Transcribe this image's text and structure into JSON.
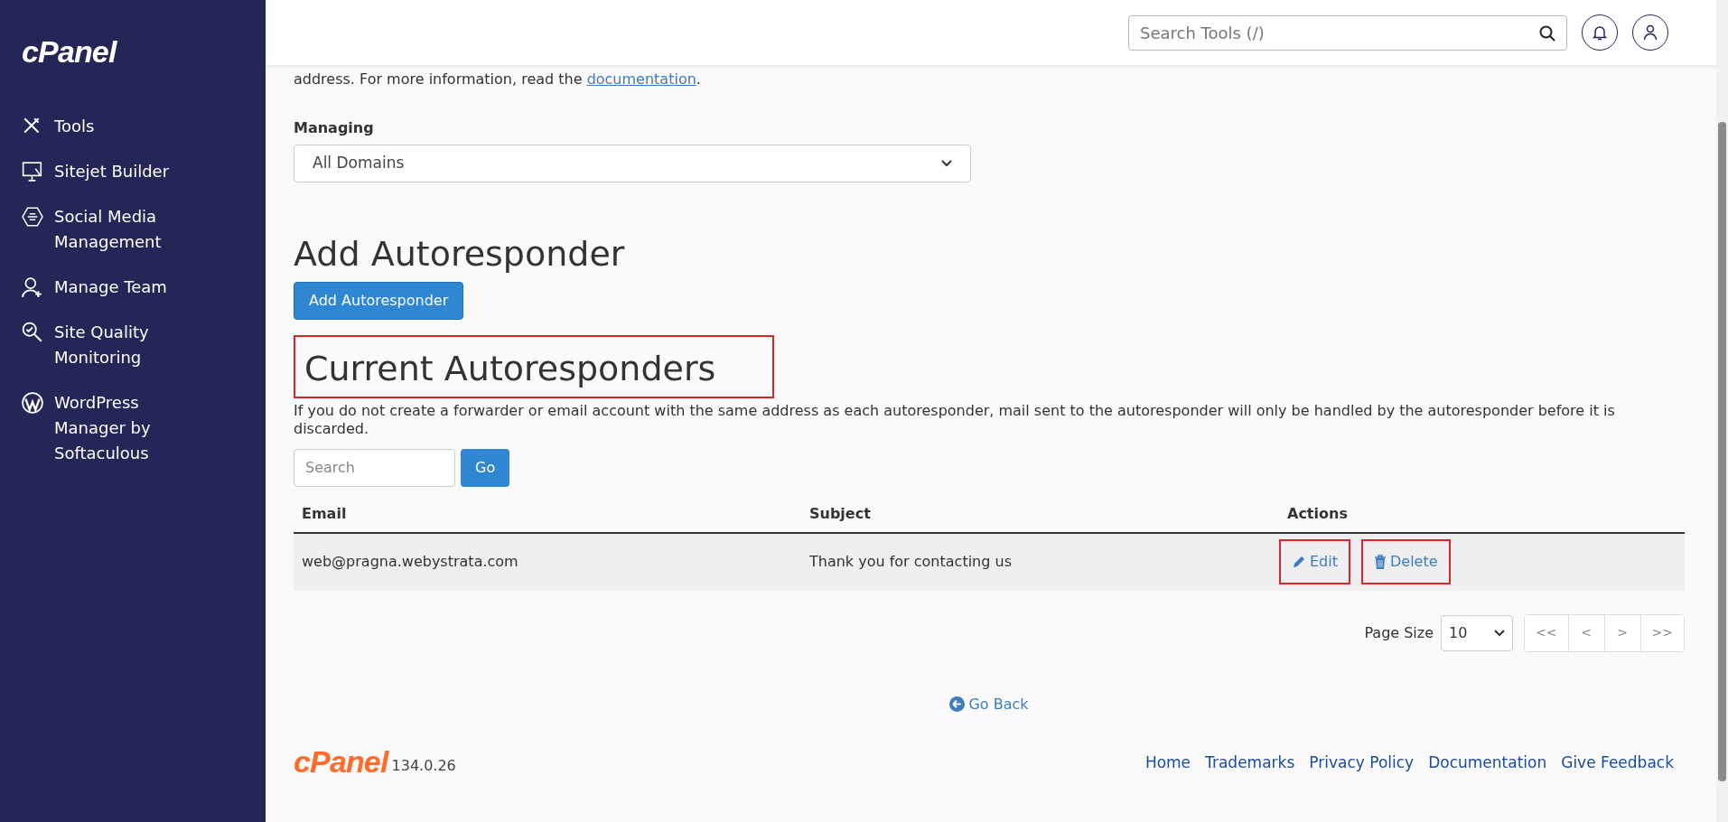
{
  "sidebar": {
    "logo": "cPanel",
    "items": [
      {
        "kind": "tools",
        "label": "Tools"
      },
      {
        "kind": "monitor",
        "label": "Sitejet Builder"
      },
      {
        "kind": "social",
        "label": "Social Media Management"
      },
      {
        "kind": "team",
        "label": "Manage Team"
      },
      {
        "kind": "quality",
        "label": "Site Quality Monitoring"
      },
      {
        "kind": "wordpress",
        "label": "WordPress Manager by Softaculous"
      }
    ]
  },
  "header": {
    "search": {
      "placeholder": "Search Tools (/)"
    }
  },
  "intro": {
    "text": "address. For more information, read the ",
    "link": "documentation",
    "end": "."
  },
  "managing": {
    "label": "Managing",
    "value": "All Domains"
  },
  "add_section": {
    "title": "Add Autoresponder",
    "button": "Add Autoresponder"
  },
  "current_section": {
    "title": "Current Autoresponders",
    "highlighted": true,
    "description": "If you do not create a forwarder or email account with the same address as each autoresponder, mail sent to the autoresponder will only be handled by the autoresponder before it is discarded.",
    "search": {
      "placeholder": "Search"
    },
    "go_button": "Go"
  },
  "table": {
    "columns": [
      "Email",
      "Subject",
      "Actions"
    ],
    "rows": [
      {
        "email": "web@pragna.webystrata.com",
        "subject": "Thank you for contacting us",
        "actions": [
          {
            "kind": "edit",
            "label": "Edit",
            "highlighted": true
          },
          {
            "kind": "delete",
            "label": "Delete",
            "highlighted": true
          }
        ]
      }
    ]
  },
  "pagination": {
    "page_size_label": "Page Size",
    "page_size": "10",
    "buttons": [
      "<<",
      "<",
      ">",
      ">>"
    ]
  },
  "go_back": "Go Back",
  "footer": {
    "logo": "cPanel",
    "version": "134.0.26",
    "links": [
      "Home",
      "Trademarks",
      "Privacy Policy",
      "Documentation",
      "Give Feedback"
    ]
  }
}
